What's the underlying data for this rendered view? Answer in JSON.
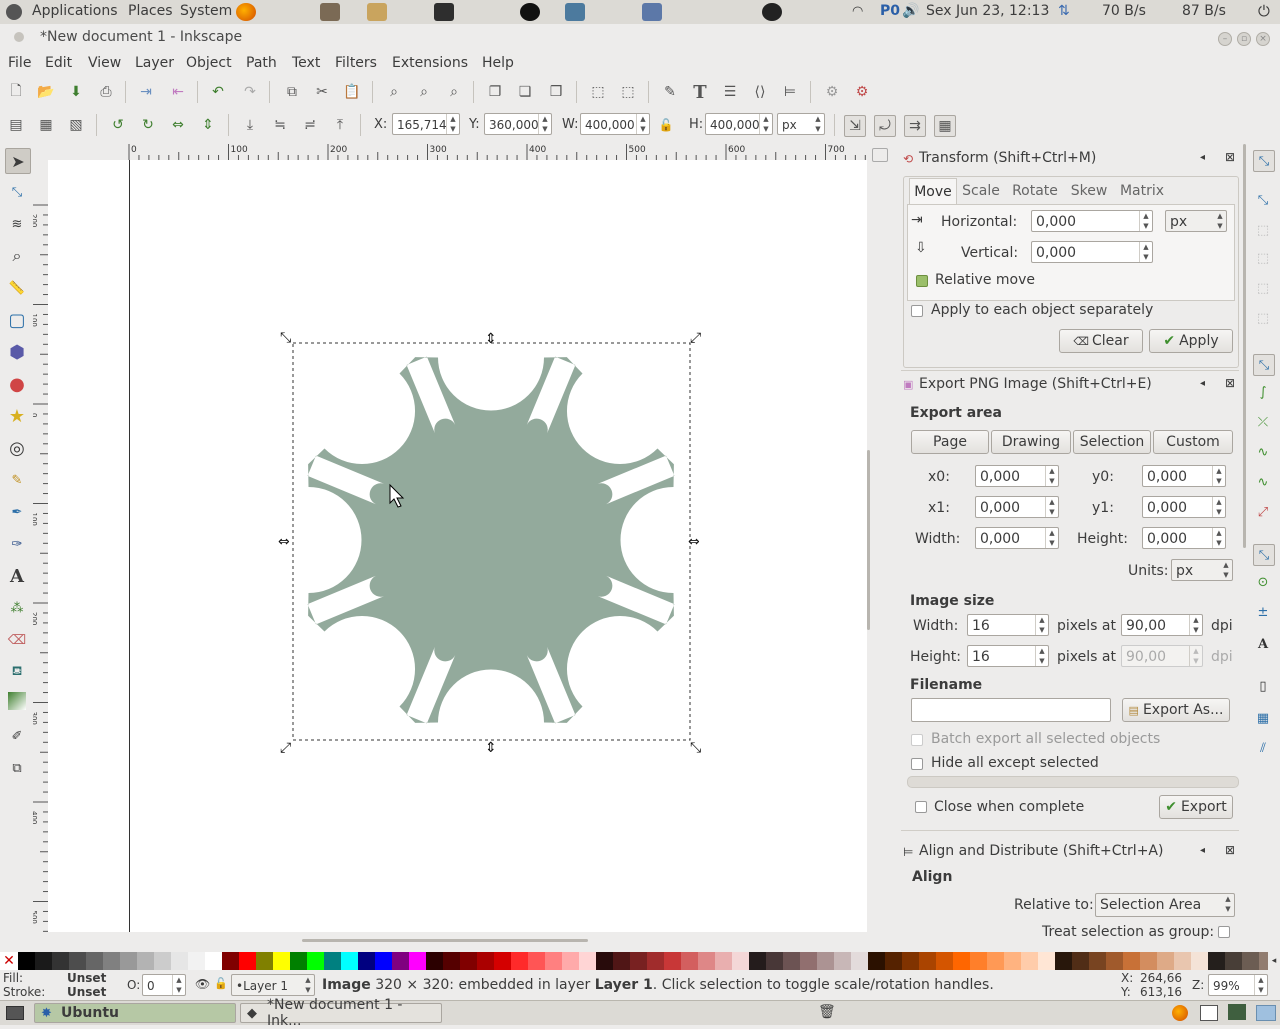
{
  "top_panel": {
    "menus": [
      "Applications",
      "Places",
      "System"
    ],
    "indicators": {
      "p0": "P0",
      "datetime": "Sex Jun 23, 12:13",
      "net_down": "70 B/s",
      "net_up": "87 B/s"
    }
  },
  "window": {
    "title": "*New document 1 - Inkscape"
  },
  "menubar": [
    "File",
    "Edit",
    "View",
    "Layer",
    "Object",
    "Path",
    "Text",
    "Filters",
    "Extensions",
    "Help"
  ],
  "controls": {
    "x_label": "X:",
    "x_value": "165,714",
    "y_label": "Y:",
    "y_value": "360,000",
    "w_label": "W:",
    "w_value": "400,000",
    "h_label": "H:",
    "h_value": "400,000",
    "unit": "px"
  },
  "ruler": {
    "h_ticks": [
      "0",
      "100",
      "200",
      "300",
      "400",
      "500",
      "600",
      "700"
    ],
    "v_ticks": [
      "200",
      "100",
      "0",
      "100",
      "200",
      "300",
      "400",
      "500",
      "600"
    ]
  },
  "transform": {
    "title": "Transform (Shift+Ctrl+M)",
    "tabs": [
      "Move",
      "Scale",
      "Rotate",
      "Skew",
      "Matrix"
    ],
    "horizontal_label": "Horizontal:",
    "horizontal_value": "0,000",
    "vertical_label": "Vertical:",
    "vertical_value": "0,000",
    "unit": "px",
    "relative_move": "Relative move",
    "apply_each": "Apply to each object separately",
    "clear": "Clear",
    "apply": "Apply"
  },
  "export": {
    "title": "Export PNG Image (Shift+Ctrl+E)",
    "area_label": "Export area",
    "area_buttons": [
      "Page",
      "Drawing",
      "Selection",
      "Custom"
    ],
    "x0_label": "x0:",
    "x0": "0,000",
    "y0_label": "y0:",
    "y0": "0,000",
    "x1_label": "x1:",
    "x1": "0,000",
    "y1_label": "y1:",
    "y1": "0,000",
    "width_label": "Width:",
    "width": "0,000",
    "height_label": "Height:",
    "height": "0,000",
    "units_label": "Units:",
    "units": "px",
    "image_size_label": "Image size",
    "img_width_label": "Width:",
    "img_width": "16",
    "img_height_label": "Height:",
    "img_height": "16",
    "pixels_at": "pixels at",
    "dpi_value": "90,00",
    "dpi_value2": "90,00",
    "dpi": "dpi",
    "filename_label": "Filename",
    "filename": "",
    "export_as": "Export As...",
    "batch": "Batch export all selected objects",
    "hide_all": "Hide all except selected",
    "close_when": "Close when complete",
    "export": "Export"
  },
  "align": {
    "title": "Align and Distribute (Shift+Ctrl+A)",
    "align_label": "Align",
    "relative_label": "Relative to:",
    "relative_value": "Selection Area",
    "treat_group": "Treat selection as group:"
  },
  "status": {
    "fill_label": "Fill:",
    "fill_value": "Unset",
    "stroke_label": "Stroke:",
    "stroke_value": "Unset",
    "opacity_label": "O:",
    "opacity_value": "0",
    "layer": "•Layer 1",
    "msg_bold": "Image",
    "msg_1": " 320 × 320: embedded in layer ",
    "msg_layer": "Layer 1",
    "msg_2": ". Click selection to toggle scale/rotation handles.",
    "coord_x_label": "X:",
    "coord_x": "264,66",
    "coord_y_label": "Y:",
    "coord_y": "613,16",
    "zoom_label": "Z:",
    "zoom": "99%"
  },
  "taskbar": {
    "ubuntu": "Ubuntu",
    "inkscape": "*New document 1 - Ink..."
  },
  "colors": {
    "shape": "#93aa9c",
    "accent": "#9bbf6a"
  },
  "palette": [
    "#000000",
    "#1a1a1a",
    "#333333",
    "#4d4d4d",
    "#666666",
    "#808080",
    "#999999",
    "#b3b3b3",
    "#cccccc",
    "#e6e6e6",
    "#f2f2f2",
    "#ffffff",
    "#800000",
    "#ff0000",
    "#808000",
    "#ffff00",
    "#008000",
    "#00ff00",
    "#008080",
    "#00ffff",
    "#000080",
    "#0000ff",
    "#800080",
    "#ff00ff",
    "#2b0000",
    "#550000",
    "#800000",
    "#aa0000",
    "#d40000",
    "#ff2a2a",
    "#ff5555",
    "#ff8080",
    "#ffaaaa",
    "#ffd5d5",
    "#280b0b",
    "#501616",
    "#782121",
    "#a02c2c",
    "#c83737",
    "#d35f5f",
    "#de8787",
    "#e9afaf",
    "#f4d7d7",
    "#241c1c",
    "#483737",
    "#6c5353",
    "#916f6f",
    "#ac9393",
    "#c8b7b7",
    "#e3dbdb",
    "#2b1100",
    "#552200",
    "#803300",
    "#aa4400",
    "#d45500",
    "#ff6600",
    "#ff7f2a",
    "#ff9955",
    "#ffb380",
    "#ffccaa",
    "#ffe6d5",
    "#28170b",
    "#502d16",
    "#784421",
    "#a05a2c",
    "#c87137",
    "#d38d5f",
    "#deaa87",
    "#e9c6af",
    "#f4e3d7",
    "#241f1c",
    "#483e37",
    "#6c5d53",
    "#917c6f",
    "#ac9d93",
    "#c8beb7"
  ]
}
